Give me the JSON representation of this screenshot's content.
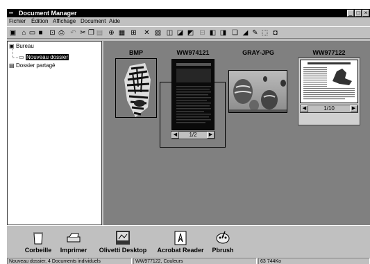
{
  "window": {
    "title": "Document Manager"
  },
  "menu": [
    "Fichier",
    "Édition",
    "Affichage",
    "Document",
    "Aide"
  ],
  "toolbar_icons": [
    "new-document-icon",
    "open-icon",
    "open-folder-icon",
    "save-icon",
    "scan-icon",
    "print-icon",
    "undo-icon",
    "cut-icon",
    "copy-icon",
    "paste-icon",
    "zoom-icon",
    "view-list-icon",
    "view-grid-icon",
    "delete-icon",
    "properties-icon",
    "page-prev-icon",
    "page-next-icon",
    "page-rotate-icon",
    "page-insert-icon",
    "page-split-icon",
    "page-merge-icon",
    "page-copy-icon",
    "annotate-icon",
    "pen-icon",
    "stamp-icon",
    "lock-icon"
  ],
  "tree": {
    "items": [
      {
        "label": "Bureau",
        "icon": "desktop-icon"
      },
      {
        "label": "Nouveau dossier",
        "icon": "open-folder-icon",
        "selected": true
      },
      {
        "label": "Dossier partagé",
        "icon": "shared-folder-icon"
      }
    ]
  },
  "documents": [
    {
      "name": "BMP",
      "image": "zebra"
    },
    {
      "name": "WW974121",
      "image": "dark-page",
      "page": "1/2",
      "selected": true
    },
    {
      "name": "GRAY-JPG",
      "image": "balloons"
    },
    {
      "name": "WW977122",
      "image": "text-page",
      "page": "1/10"
    }
  ],
  "dock": [
    {
      "label": "Corbeille",
      "icon": "trash-icon"
    },
    {
      "label": "Imprimer",
      "icon": "printer-icon"
    },
    {
      "label": "Olivetti Desktop",
      "icon": "desktop-app-icon"
    },
    {
      "label": "Acrobat Reader",
      "icon": "acrobat-icon"
    },
    {
      "label": "Pbrush",
      "icon": "paintbrush-icon"
    }
  ],
  "status": {
    "left": "Nouveau dossier, 4 Documents individuels",
    "middle": "WW977122, Couleurs",
    "right": "63 744Ko"
  },
  "window_controls": [
    "_",
    "□",
    "×"
  ],
  "pager_prev": "◀",
  "pager_next": "▶"
}
